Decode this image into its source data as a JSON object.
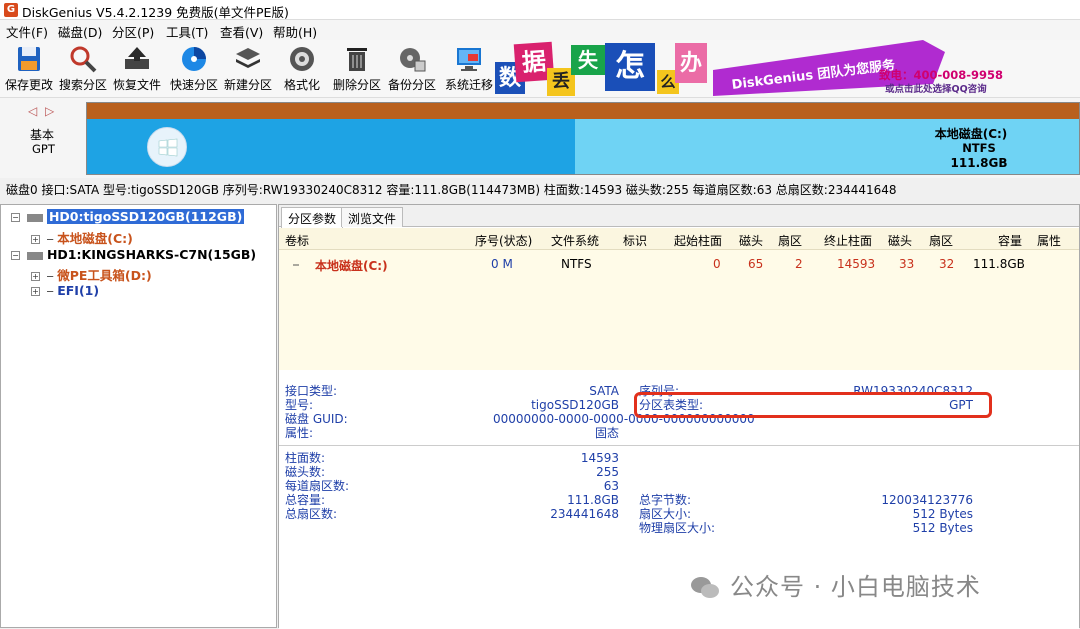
{
  "window": {
    "title": "DiskGenius V5.4.2.1239 免费版(单文件PE版)"
  },
  "menu": [
    "文件(F)",
    "磁盘(D)",
    "分区(P)",
    "工具(T)",
    "查看(V)",
    "帮助(H)"
  ],
  "toolbar": [
    "保存更改",
    "搜索分区",
    "恢复文件",
    "快速分区",
    "新建分区",
    "格式化",
    "删除分区",
    "备份分区",
    "系统迁移"
  ],
  "banner": {
    "tiles": [
      "数",
      "据",
      "丢",
      "失",
      "怎",
      "么",
      "办"
    ],
    "slogan": "DiskGenius 团队为您服务",
    "hotline": "致电：400-008-9958",
    "qq": "或点击此处选择QQ咨询"
  },
  "diskmap": {
    "nav": "◁ ▷",
    "type": "基本",
    "table": "GPT",
    "partition": {
      "name": "本地磁盘(C:)",
      "fs": "NTFS",
      "size": "111.8GB"
    }
  },
  "disk_info": "磁盘0 接口:SATA  型号:tigoSSD120GB  序列号:RW19330240C8312  容量:111.8GB(114473MB)  柱面数:14593  磁头数:255  每道扇区数:63  总扇区数:234441648",
  "tree": {
    "hd0": "HD0:tigoSSD120GB(112GB)",
    "hd0_c": "本地磁盘(C:)",
    "hd1": "HD1:KINGSHARKS-C7N(15GB)",
    "hd1_d": "微PE工具箱(D:)",
    "hd1_efi": "EFI(1)"
  },
  "tabs": [
    "分区参数",
    "浏览文件"
  ],
  "columns": [
    "卷标",
    "序号(状态)",
    "文件系统",
    "标识",
    "起始柱面",
    "磁头",
    "扇区",
    "终止柱面",
    "磁头",
    "扇区",
    "容量",
    "属性"
  ],
  "row": {
    "label": "本地磁盘(C:)",
    "index": "0 M",
    "fs": "NTFS",
    "flag": "",
    "start_cyl": "0",
    "start_head": "65",
    "start_sec": "2",
    "end_cyl": "14593",
    "end_head": "33",
    "end_sec": "32",
    "capacity": "111.8GB",
    "attr": ""
  },
  "details": {
    "iface_l": "接口类型:",
    "iface_v": "SATA",
    "serial_l": "序列号:",
    "serial_v": "RW19330240C8312",
    "model_l": "型号:",
    "model_v": "tigoSSD120GB",
    "pttype_l": "分区表类型:",
    "pttype_v": "GPT",
    "guid_l": "磁盘 GUID:",
    "guid_v": "00000000-0000-0000-0000-000000000000",
    "attr_l": "属性:",
    "attr_v": "固态",
    "cyl_l": "柱面数:",
    "cyl_v": "14593",
    "heads_l": "磁头数:",
    "heads_v": "255",
    "spt_l": "每道扇区数:",
    "spt_v": "63",
    "cap_l": "总容量:",
    "cap_v": "111.8GB",
    "bytes_l": "总字节数:",
    "bytes_v": "120034123776",
    "secs_l": "总扇区数:",
    "secs_v": "234441648",
    "secsize_l": "扇区大小:",
    "secsize_v": "512 Bytes",
    "phys_l": "物理扇区大小:",
    "phys_v": "512 Bytes"
  },
  "watermark": "公众号 · 小白电脑技术"
}
